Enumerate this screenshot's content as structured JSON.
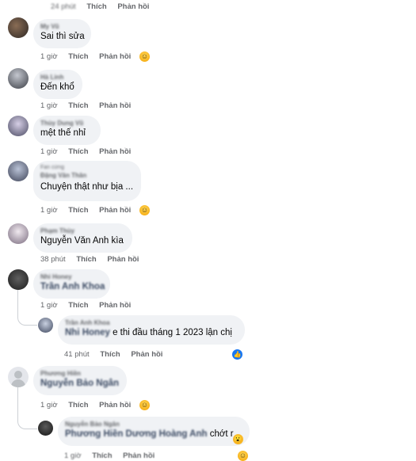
{
  "comments": [
    {
      "time": "24 phút",
      "like": "Thích",
      "reply": "Phản hồi"
    },
    {
      "author": "My Vũ",
      "text": "Sai thì sửa",
      "time": "1 giờ",
      "like": "Thích",
      "reply": "Phản hồi",
      "reaction_icon": "haha-emoji"
    },
    {
      "author": "Hà Linh",
      "text": "Đến khổ",
      "time": "1 giờ",
      "like": "Thích",
      "reply": "Phản hồi"
    },
    {
      "author": "Thùy Dung Vũ",
      "text": "mệt thế nhỉ",
      "time": "1 giờ",
      "like": "Thích",
      "reply": "Phản hồi"
    },
    {
      "badge": "Fan cứng",
      "author": "Đặng Văn Thân",
      "text": "Chuyện thật như bịa ...",
      "time": "1 giờ",
      "like": "Thích",
      "reply": "Phản hồi",
      "reaction_icon": "haha-emoji"
    },
    {
      "author": "Phạm Thùy",
      "text": "Nguyễn Văn Anh kìa",
      "time": "38 phút",
      "like": "Thích",
      "reply": "Phản hồi"
    },
    {
      "author": "Nhi Honey",
      "mention": "Trần Anh Khoa",
      "time": "1 giờ",
      "like": "Thích",
      "reply": "Phản hồi"
    },
    {
      "author": "Trần Anh Khoa",
      "mention": "Nhi Honey",
      "text": "e thi đầu tháng 1 2023 lận chị",
      "time": "41 phút",
      "like": "Thích",
      "reply": "Phản hồi",
      "reaction_icon": "like-icon"
    },
    {
      "author": "Phương Hiền",
      "mention": "Nguyễn Bảo Ngân",
      "time": "1 giờ",
      "like": "Thích",
      "reply": "Phản hồi",
      "reaction_icon": "haha-emoji"
    },
    {
      "author": "Nguyễn Bảo Ngân",
      "mention": "Phương Hiền Dương Hoàng Anh",
      "text": "chớt r",
      "time": "1 giờ",
      "like": "Thích",
      "reply": "Phản hồi",
      "reaction_icon": "wow-emoji"
    }
  ]
}
